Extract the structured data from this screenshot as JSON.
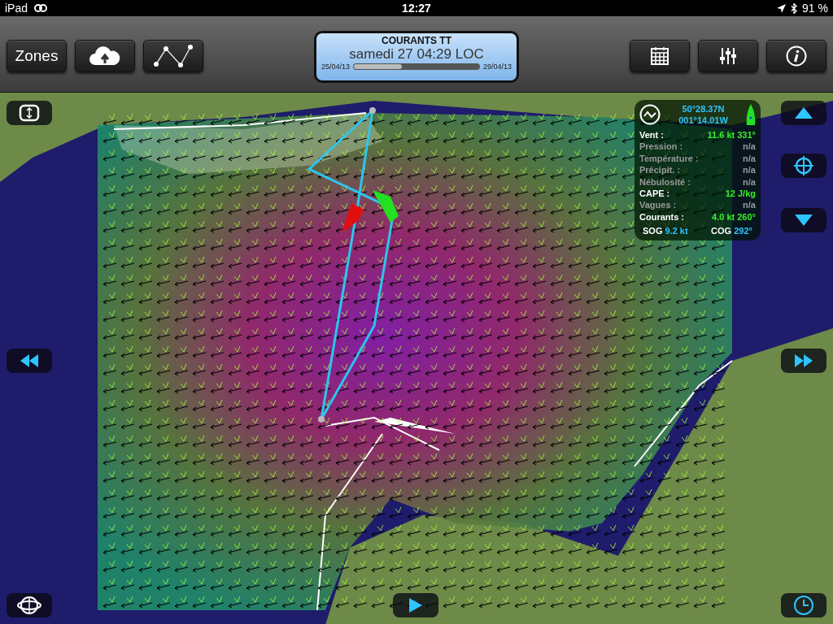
{
  "status_bar": {
    "carrier": "iPad",
    "time": "12:27",
    "battery": "91 %"
  },
  "toolbar": {
    "left_buttons": [
      {
        "kind": "text",
        "label": "Zones"
      },
      {
        "kind": "cloud"
      },
      {
        "kind": "route"
      }
    ],
    "timeline": {
      "title": "COURANTS TT",
      "datetime": "samedi 27 04:29 LOC",
      "start": "25/04/13",
      "end": "29/04/13",
      "level": 0.38
    },
    "right_buttons": [
      {
        "kind": "calendar"
      },
      {
        "kind": "sliders"
      },
      {
        "kind": "info"
      }
    ]
  },
  "info_panel": {
    "lat": "50°28.37N",
    "lon": "001°14.01W",
    "rows": [
      {
        "label": "Vent :",
        "value": "11.6 kt 331°",
        "available": true
      },
      {
        "label": "Pression :",
        "value": "n/a",
        "available": false
      },
      {
        "label": "Température :",
        "value": "n/a",
        "available": false
      },
      {
        "label": "Précipit. :",
        "value": "n/a",
        "available": false
      },
      {
        "label": "Nébulosité :",
        "value": "n/a",
        "available": false
      },
      {
        "label": "CAPE :",
        "value": "12 J/kg",
        "available": true
      },
      {
        "label": "Vagues :",
        "value": "n/a",
        "available": false
      },
      {
        "label": "Courants :",
        "value": "4.0 kt 260°",
        "available": true
      }
    ],
    "sog_label": "SOG",
    "sog": "9.2 kt",
    "cog_label": "COG",
    "cog": "292°"
  }
}
